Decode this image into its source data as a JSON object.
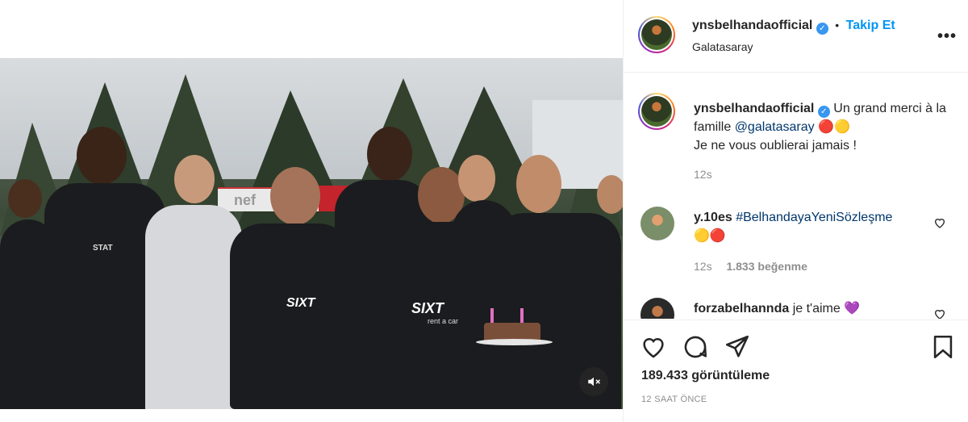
{
  "post": {
    "username": "ynsbelhandaofficial",
    "verified": true,
    "follow_label": "Takip Et",
    "separator": "•",
    "location": "Galatasaray",
    "more_icon": "more-options-icon"
  },
  "caption": {
    "username": "ynsbelhandaofficial",
    "text_before": "Un grand merci à la famille ",
    "mention": "@galatasaray",
    "emoji_tail": "🔴🟡",
    "line2": "Je ne vous oublierai jamais !",
    "time": "12s"
  },
  "comments": [
    {
      "username": "y.10es",
      "hashtag": "#BelhandayaYeniSözleşme",
      "emoji": "🟡🔴",
      "time": "12s",
      "likes": "1.833 beğenme"
    },
    {
      "username": "forzabelhannda",
      "text": "je t'aime",
      "emoji": "💜"
    }
  ],
  "stats": {
    "views": "189.433 görüntüleme",
    "time_ago": "12 SAAT ÖNCE"
  },
  "video": {
    "mute_icon": "speaker-muted-icon",
    "banner_text_left": "nef",
    "sponsor_text": "SIXT",
    "sponsor_sub": "rent a car",
    "sponsor_stat": "STAT"
  },
  "colors": {
    "accent": "#0095f6",
    "verified": "#3897f0",
    "mention": "#00376b",
    "muted": "#8e8e8e"
  }
}
